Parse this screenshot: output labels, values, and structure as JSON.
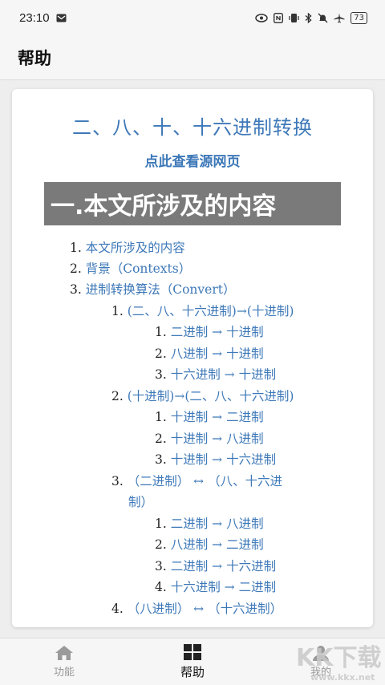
{
  "status": {
    "time": "23:10",
    "battery": "73"
  },
  "appbar": {
    "title": "帮助"
  },
  "doc": {
    "title": "二、八、十、十六进制转换",
    "source_link": "点此查看源网页",
    "section_heading": "一.本文所涉及的内容",
    "toc": [
      {
        "num": "1.",
        "text": "本文所涉及的内容"
      },
      {
        "num": "2.",
        "text": "背景（Contexts）"
      },
      {
        "num": "3.",
        "text": "进制转换算法（Convert）"
      },
      {
        "num": "1.",
        "text": "(二、八、十六进制)→(十进制)"
      },
      {
        "num": "1.",
        "text": "二进制 → 十进制"
      },
      {
        "num": "2.",
        "text": "八进制 → 十进制"
      },
      {
        "num": "3.",
        "text": "十六进制 → 十进制"
      },
      {
        "num": "2.",
        "text": "(十进制)→(二、八、十六进制)"
      },
      {
        "num": "1.",
        "text": "十进制 → 二进制"
      },
      {
        "num": "2.",
        "text": "十进制 → 八进制"
      },
      {
        "num": "3.",
        "text": "十进制 → 十六进制"
      },
      {
        "num": "3.",
        "text": "（二进制） ↔ （八、十六进"
      },
      {
        "num": "",
        "text": "制）"
      },
      {
        "num": "1.",
        "text": "二进制 → 八进制"
      },
      {
        "num": "2.",
        "text": "八进制 → 二进制"
      },
      {
        "num": "3.",
        "text": "二进制 → 十六进制"
      },
      {
        "num": "4.",
        "text": "十六进制 → 二进制"
      },
      {
        "num": "4.",
        "text": "（八进制） ↔ （十六进制）"
      }
    ]
  },
  "nav": {
    "items": [
      {
        "label": "功能",
        "icon": "home-icon"
      },
      {
        "label": "帮助",
        "icon": "grid-icon"
      },
      {
        "label": "我的",
        "icon": "person-icon"
      }
    ],
    "active": "帮助"
  },
  "watermark": {
    "text": "KK下载",
    "url_text": "www.kkx.net"
  },
  "colors": {
    "link": "#3d78b8",
    "heading_bg": "#7a7a7a"
  }
}
